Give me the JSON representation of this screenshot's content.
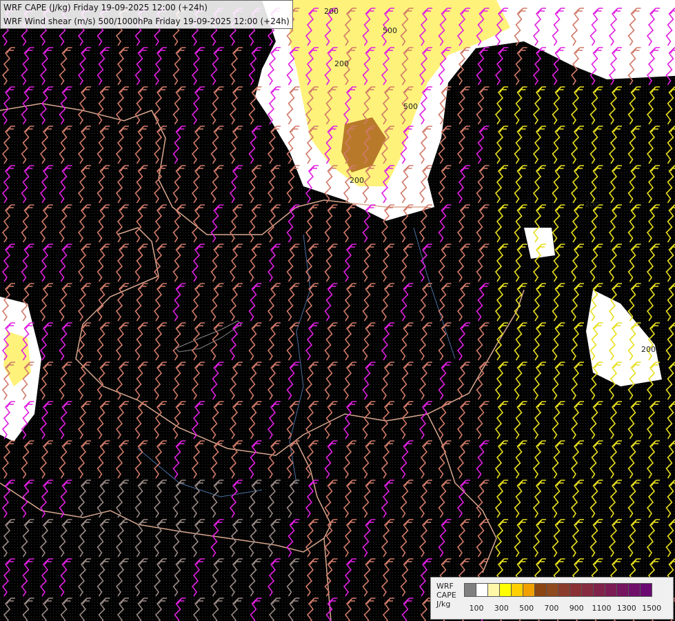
{
  "titles": {
    "line1": "WRF CAPE (J/kg) Friday 19-09-2025 12:00 (+24h)",
    "line2": "WRF Wind shear (m/s) 500/1000hPa Friday 19-09-2025 12:00 (+24h)"
  },
  "map_labels": [
    "200",
    "500",
    "200",
    "500",
    "200",
    "200",
    "200"
  ],
  "legend": {
    "label_line1": "WRF",
    "label_line2": "CAPE",
    "label_line3": "J/kg",
    "colors": [
      "#808080",
      "#ffffff",
      "#fff6a8",
      "#ffff00",
      "#ffd000",
      "#f0a000",
      "#8b4513",
      "#8f4a20",
      "#8c3c2a",
      "#8a3035",
      "#862a40",
      "#80234a",
      "#7c1c55",
      "#761560",
      "#700f6a",
      "#6a0a72"
    ],
    "ticks": [
      "100",
      "300",
      "500",
      "700",
      "900",
      "1100",
      "1300",
      "1500"
    ]
  },
  "layer_colors": {
    "barb_magenta": "#e020e0",
    "barb_salmon": "#d07a6a",
    "barb_yellow": "#e8e020",
    "barb_grey": "#9a8a86",
    "border": "#d9a890",
    "river": "#4a6fa0",
    "cape_white": "#ffffff",
    "cape_yellow": "#fff27a"
  }
}
